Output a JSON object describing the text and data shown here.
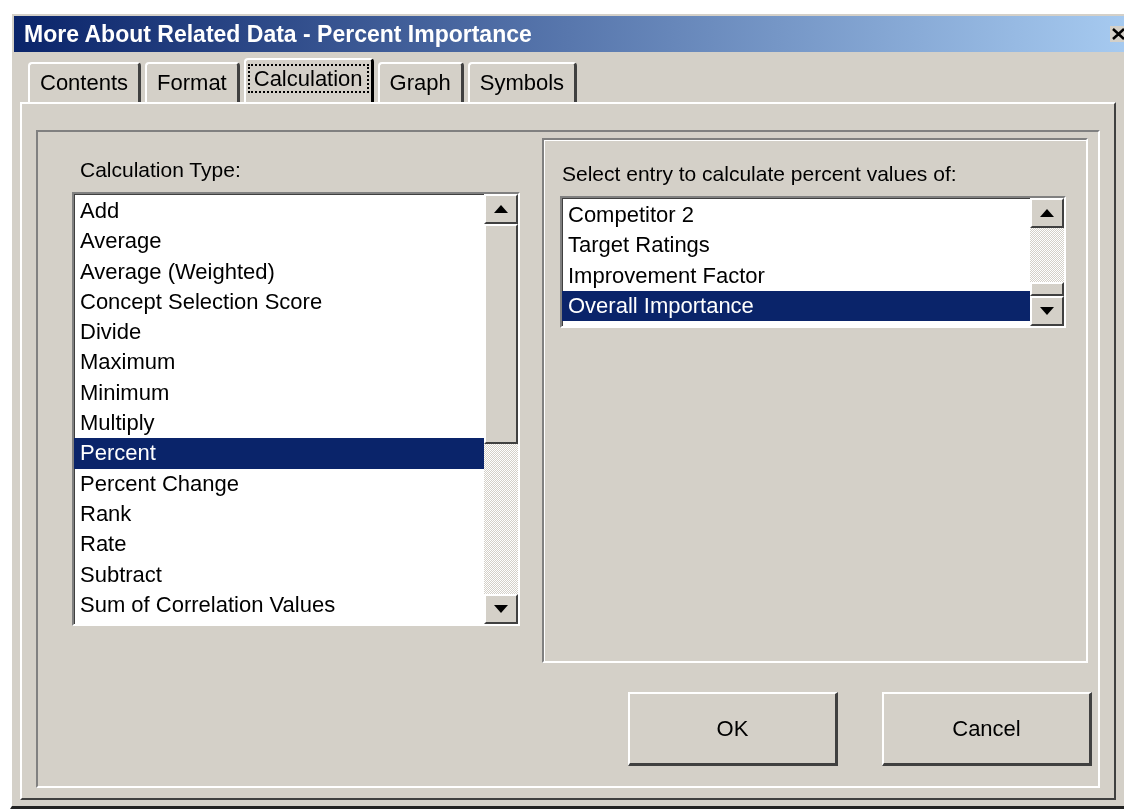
{
  "window": {
    "title": "More About Related Data - Percent Importance"
  },
  "tabs": [
    {
      "label": "Contents",
      "selected": false
    },
    {
      "label": "Format",
      "selected": false
    },
    {
      "label": "Calculation",
      "selected": true
    },
    {
      "label": "Graph",
      "selected": false
    },
    {
      "label": "Symbols",
      "selected": false
    }
  ],
  "calculation_type": {
    "label": "Calculation Type:",
    "items": [
      {
        "label": "Add",
        "selected": false
      },
      {
        "label": "Average",
        "selected": false
      },
      {
        "label": "Average (Weighted)",
        "selected": false
      },
      {
        "label": "Concept Selection Score",
        "selected": false
      },
      {
        "label": "Divide",
        "selected": false
      },
      {
        "label": "Maximum",
        "selected": false
      },
      {
        "label": "Minimum",
        "selected": false
      },
      {
        "label": "Multiply",
        "selected": false
      },
      {
        "label": "Percent",
        "selected": true
      },
      {
        "label": "Percent Change",
        "selected": false
      },
      {
        "label": "Rank",
        "selected": false
      },
      {
        "label": "Rate",
        "selected": false
      },
      {
        "label": "Subtract",
        "selected": false
      },
      {
        "label": "Sum of Correlation Values",
        "selected": false
      }
    ]
  },
  "entry": {
    "label": "Select entry to calculate percent values of:",
    "items": [
      {
        "label": "Competitor 2",
        "selected": false
      },
      {
        "label": "Target Ratings",
        "selected": false
      },
      {
        "label": "Improvement Factor",
        "selected": false
      },
      {
        "label": "Overall Importance",
        "selected": true
      }
    ]
  },
  "buttons": [
    {
      "label": "OK"
    },
    {
      "label": "Cancel"
    }
  ]
}
